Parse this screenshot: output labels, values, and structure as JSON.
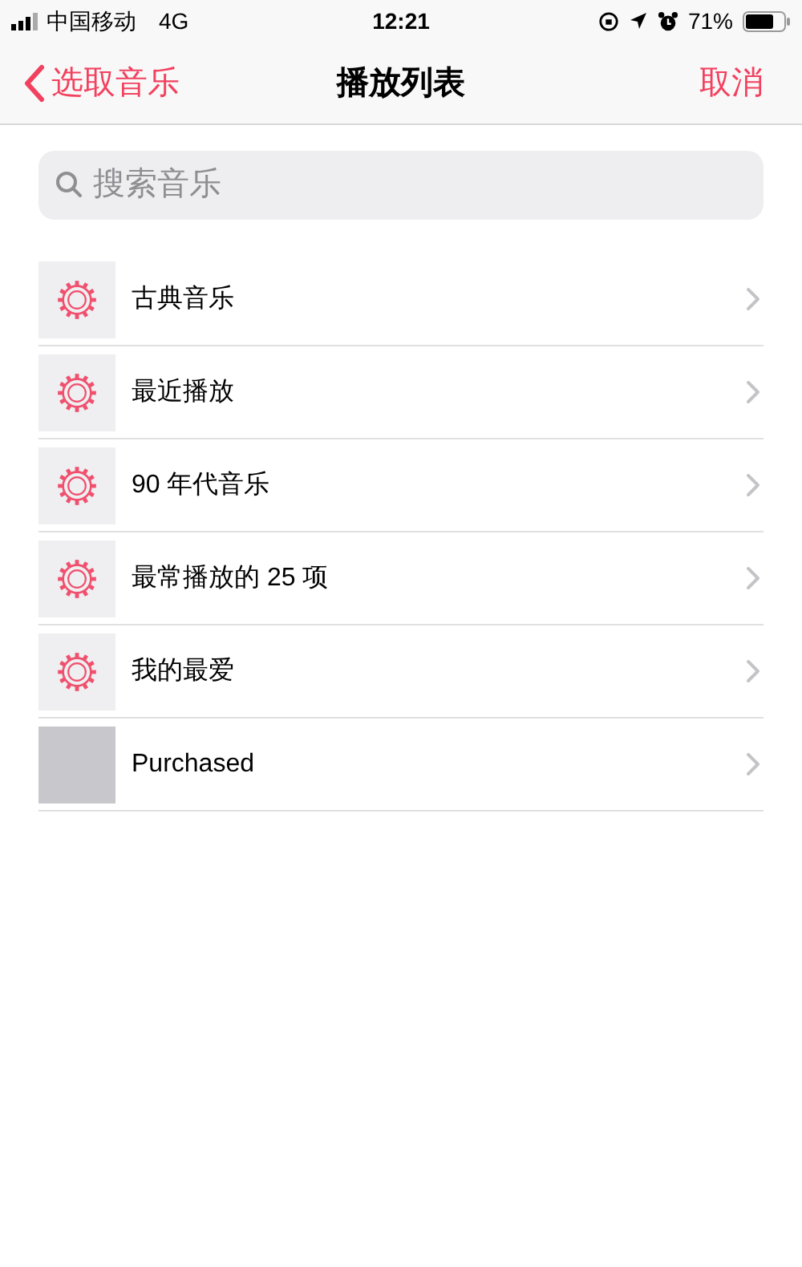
{
  "status_bar": {
    "carrier": "中国移动",
    "network": "4G",
    "time": "12:21",
    "battery": "71%"
  },
  "nav": {
    "back": "选取音乐",
    "title": "播放列表",
    "cancel": "取消"
  },
  "search": {
    "placeholder": "搜索音乐"
  },
  "playlists": [
    {
      "name": "古典音乐",
      "kind": "smart"
    },
    {
      "name": "最近播放",
      "kind": "smart"
    },
    {
      "name": "90 年代音乐",
      "kind": "smart"
    },
    {
      "name": "最常播放的 25 项",
      "kind": "smart"
    },
    {
      "name": "我的最爱",
      "kind": "smart"
    },
    {
      "name": "Purchased",
      "kind": "plain"
    }
  ]
}
